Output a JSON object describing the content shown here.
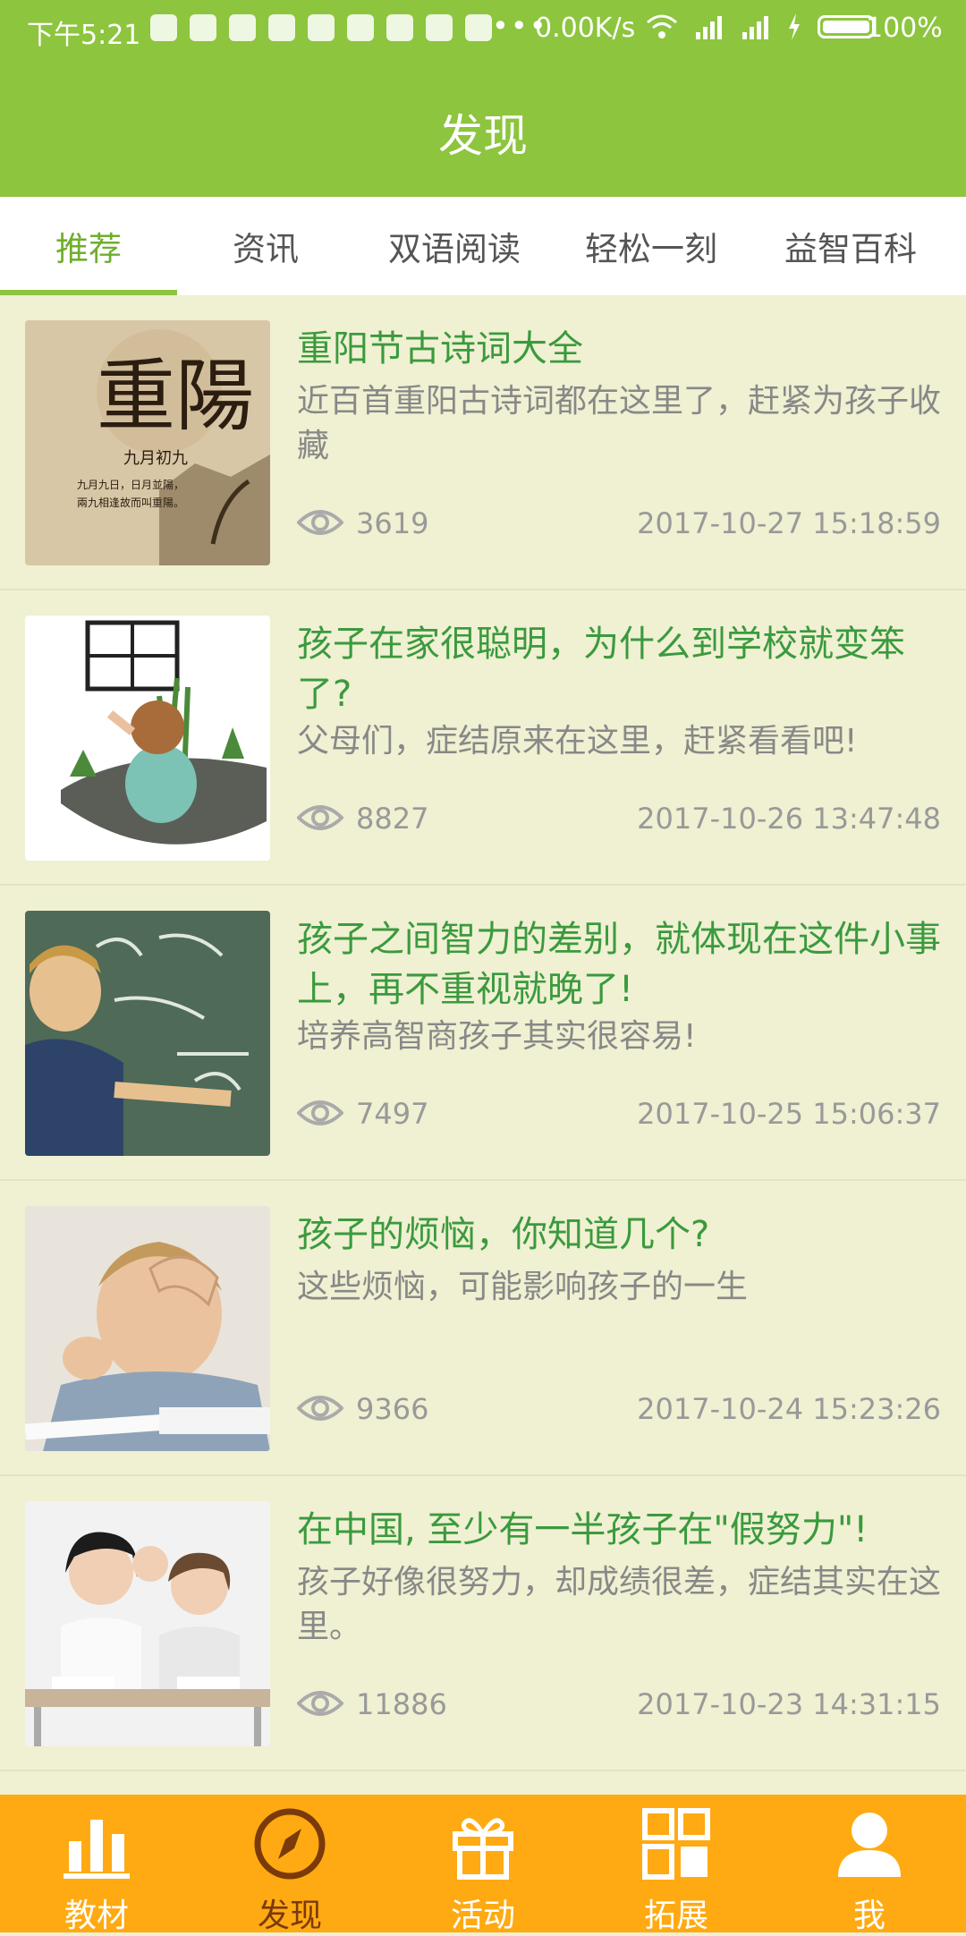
{
  "status_bar": {
    "time": "下午5:21",
    "net_speed": "0.00K/s",
    "battery_pct": "100%"
  },
  "header": {
    "title": "发现"
  },
  "tabs": [
    {
      "label": "推荐",
      "active": true
    },
    {
      "label": "资讯",
      "active": false
    },
    {
      "label": "双语阅读",
      "active": false
    },
    {
      "label": "轻松一刻",
      "active": false
    },
    {
      "label": "益智百科",
      "active": false
    }
  ],
  "articles": [
    {
      "title": "重阳节古诗词大全",
      "desc": "近百首重阳古诗词都在这里了，赶紧为孩子收藏",
      "views": "3619",
      "date": "2017-10-27 15:18:59",
      "thumb": {
        "icon": "chongyang-poster-image",
        "text_main": "重陽",
        "text_sub": "九月初九",
        "text_lines": [
          "九月九日，日月並陽，",
          "兩九相逢故而叫重陽。"
        ]
      }
    },
    {
      "title": "孩子在家很聪明，为什么到学校就变笨了?",
      "desc": "父母们，症结原来在这里，赶紧看看吧!",
      "views": "8827",
      "date": "2017-10-26 13:47:48",
      "thumb": {
        "icon": "girl-at-window-illustration"
      }
    },
    {
      "title": "孩子之间智力的差别，就体现在这件小事上，再不重视就晚了!",
      "desc": "培养高智商孩子其实很容易!",
      "views": "7497",
      "date": "2017-10-25 15:06:37",
      "thumb": {
        "icon": "boy-at-chalkboard-photo"
      }
    },
    {
      "title": "孩子的烦恼，你知道几个?",
      "desc": "这些烦恼，可能影响孩子的一生",
      "views": "9366",
      "date": "2017-10-24 15:23:26",
      "thumb": {
        "icon": "frustrated-boy-photo"
      }
    },
    {
      "title": "在中国, 至少有一半孩子在\"假努力\"!",
      "desc": "孩子好像很努力，却成绩很差，症结其实在这里。",
      "views": "11886",
      "date": "2017-10-23 14:31:15",
      "thumb": {
        "icon": "students-in-class-photo"
      }
    }
  ],
  "bottom_nav": [
    {
      "label": "教材",
      "icon": "bar-chart-icon",
      "active": false
    },
    {
      "label": "发现",
      "icon": "compass-icon",
      "active": true
    },
    {
      "label": "活动",
      "icon": "gift-icon",
      "active": false
    },
    {
      "label": "拓展",
      "icon": "grid-icon",
      "active": false
    },
    {
      "label": "我",
      "icon": "person-icon",
      "active": false
    }
  ],
  "colors": {
    "brand_green": "#8dc53e",
    "title_green": "#3a9a3e",
    "nav_orange": "#ffaa12",
    "card_bg": "#f0f0d2"
  }
}
